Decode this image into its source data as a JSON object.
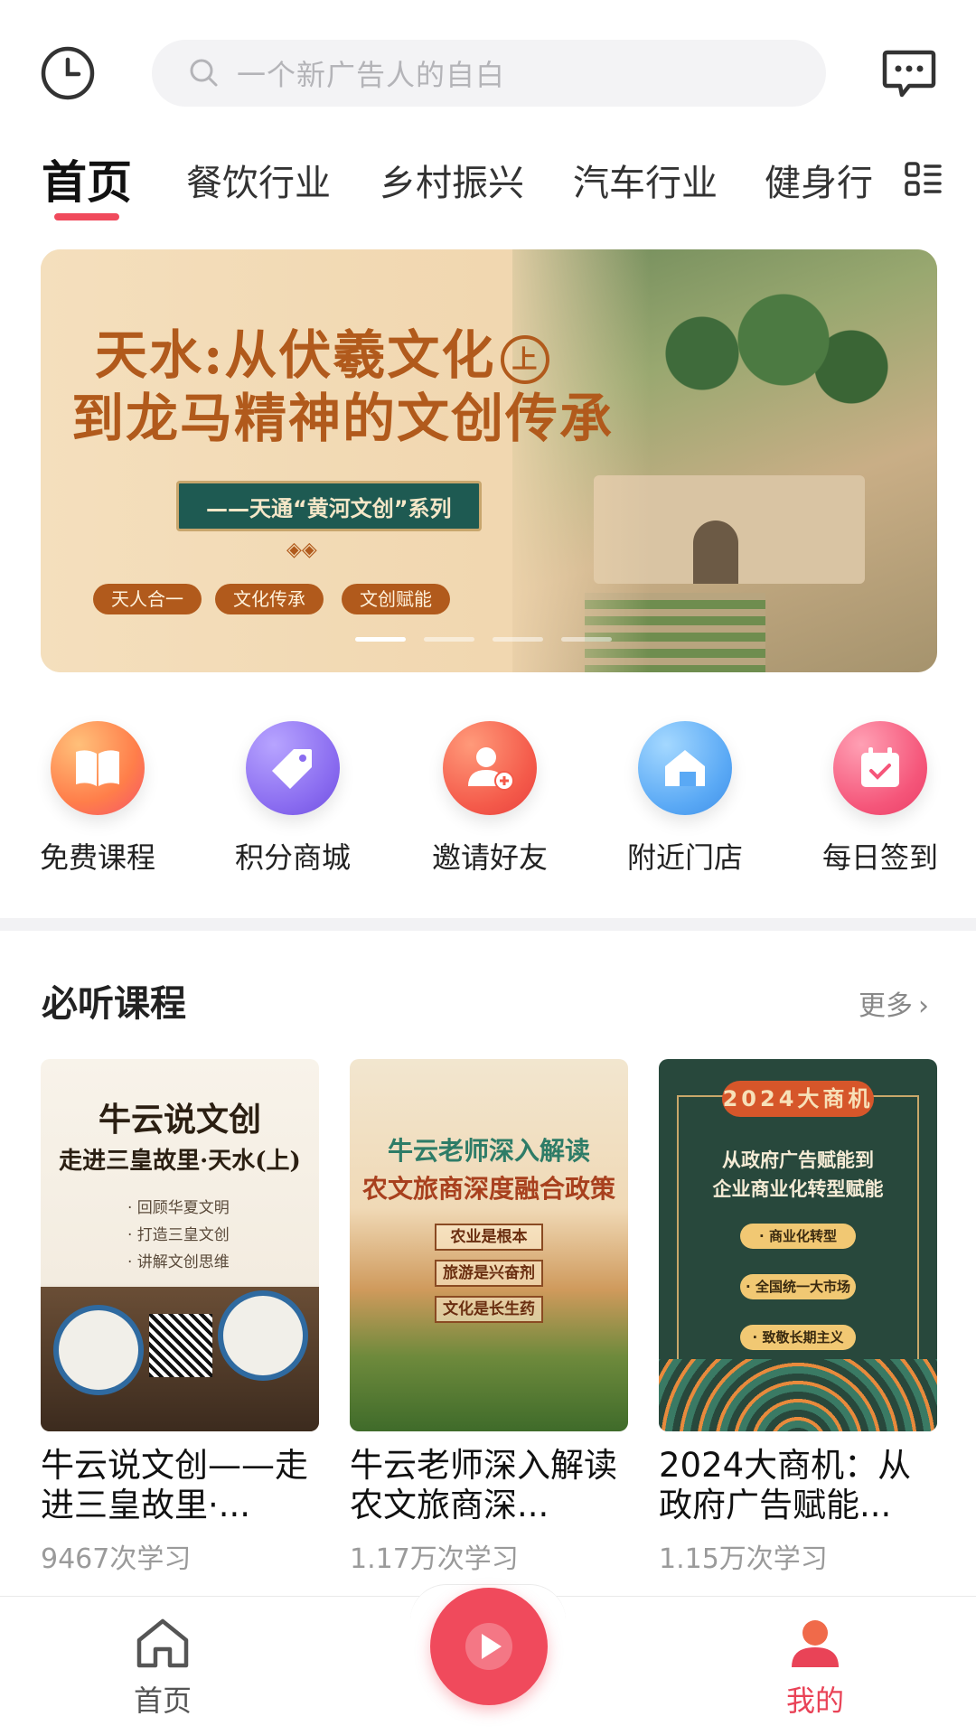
{
  "header": {
    "search_placeholder": "一个新广告人的自白"
  },
  "tabs": [
    {
      "label": "首页",
      "active": true
    },
    {
      "label": "餐饮行业"
    },
    {
      "label": "乡村振兴"
    },
    {
      "label": "汽车行业"
    },
    {
      "label": "健身行"
    }
  ],
  "banner": {
    "title_line1": "天水:从伏羲文化",
    "upper_mark": "上",
    "title_line2": "到龙马精神的文创传承",
    "series": "——天通“黄河文创”系列",
    "tags": [
      "天人合一",
      "文化传承",
      "文创赋能"
    ],
    "slide_count": 4,
    "active_slide": 1
  },
  "quick_entries": [
    {
      "label": "免费课程",
      "icon": "book-icon",
      "color": "#ff8a4c"
    },
    {
      "label": "积分商城",
      "icon": "tag-icon",
      "color": "#8a6cf0"
    },
    {
      "label": "邀请好友",
      "icon": "add-user-icon",
      "color": "#f45a4a"
    },
    {
      "label": "附近门店",
      "icon": "store-icon",
      "color": "#5aa9f5"
    },
    {
      "label": "每日签到",
      "icon": "calendar-check-icon",
      "color": "#f5567a"
    }
  ],
  "section": {
    "title": "必听课程",
    "more": "更多"
  },
  "courses": [
    {
      "title": "牛云说文创——走进三皇故里·...",
      "stat": "9467次学习",
      "cover": {
        "h1": "牛云说文创",
        "h2": "走进三皇故里·天水(上)",
        "bullets": [
          "· 回顾华夏文明",
          "· 打造三皇文创",
          "· 讲解文创思维"
        ]
      }
    },
    {
      "title": "牛云老师深入解读农文旅商深...",
      "stat": "1.17万次学习",
      "cover": {
        "h1": "牛云老师深入解读",
        "h2": "农文旅商深度融合政策",
        "tags": [
          "农业是根本",
          "旅游是兴奋剂",
          "文化是长生药"
        ]
      }
    },
    {
      "title": "2024大商机：从政府广告赋能...",
      "stat": "1.15万次学习",
      "cover": {
        "badge": "2024大商机",
        "h1": "从政府广告赋能到",
        "h2": "企业商业化转型赋能",
        "labels": [
          "· 商业化转型",
          "· 全国统一大市场",
          "· 致敬长期主义"
        ]
      }
    }
  ],
  "bottom_nav": {
    "home": "首页",
    "mine": "我的",
    "accent": "#e94357"
  }
}
